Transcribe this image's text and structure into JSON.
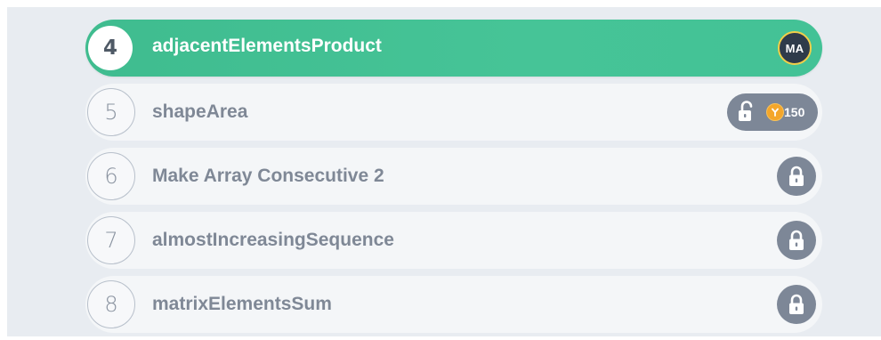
{
  "tasks": [
    {
      "number": "4",
      "title": "adjacentElementsProduct",
      "state": "current",
      "avatar_initials": "MA"
    },
    {
      "number": "5",
      "title": "shapeArea",
      "state": "unlockable",
      "unlock_icon": "unlocked-padlock-icon",
      "coin_icon": "coin-icon",
      "cost": "150"
    },
    {
      "number": "6",
      "title": "Make Array Consecutive 2",
      "state": "locked",
      "lock_icon": "padlock-icon"
    },
    {
      "number": "7",
      "title": "almostIncreasingSequence",
      "state": "locked",
      "lock_icon": "padlock-icon"
    },
    {
      "number": "8",
      "title": "matrixElementsSum",
      "state": "locked",
      "lock_icon": "padlock-icon"
    }
  ],
  "colors": {
    "active_green": "#43c296",
    "row_bg": "#f4f6f8",
    "panel_bg": "#e8ecf1",
    "lock_gray": "#7d8797",
    "coin_orange": "#f4a62a",
    "avatar_ring": "#f2cf48",
    "avatar_bg": "#2f3b4a"
  }
}
